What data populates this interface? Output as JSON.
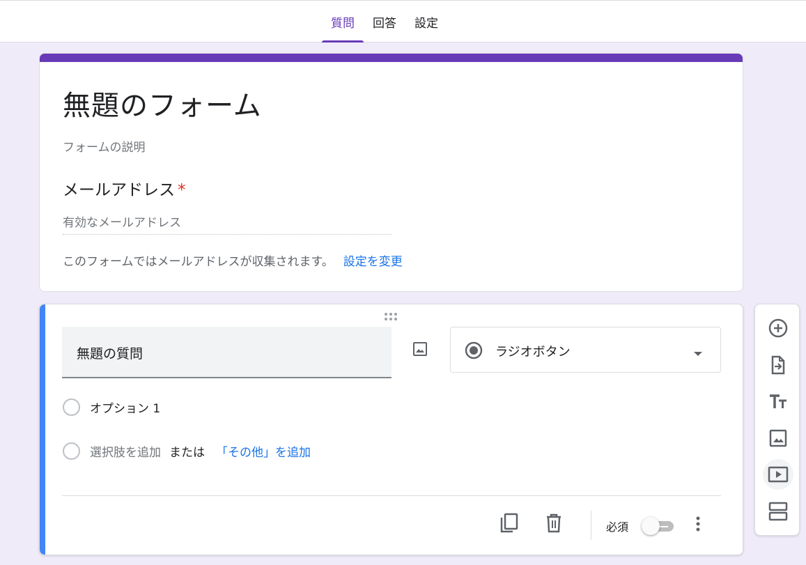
{
  "tabs": [
    {
      "label": "質問",
      "active": true
    },
    {
      "label": "回答",
      "active": false
    },
    {
      "label": "設定",
      "active": false
    }
  ],
  "header": {
    "title": "無題のフォーム",
    "description": "フォームの説明",
    "email_label": "メールアドレス",
    "required_mark": "*",
    "email_placeholder": "有効なメールアドレス",
    "collect_note": "このフォームではメールアドレスが収集されます。",
    "change_settings_link": "設定を変更"
  },
  "question": {
    "title": "無題の質問",
    "type": "ラジオボタン",
    "option_1": "オプション 1",
    "add_option": "選択肢を追加",
    "or_text": "または",
    "add_other": "「その他」を追加",
    "required_label": "必須",
    "required_on": false
  },
  "toolbar": {
    "icons": [
      "add-question-icon",
      "import-questions-icon",
      "add-title-icon",
      "add-image-icon",
      "add-video-icon",
      "add-section-icon"
    ]
  },
  "colors": {
    "accent": "#673ab7",
    "background": "#f0ebf8",
    "question_accent": "#4285f4",
    "link": "#1a73e8",
    "required": "#d93025"
  }
}
